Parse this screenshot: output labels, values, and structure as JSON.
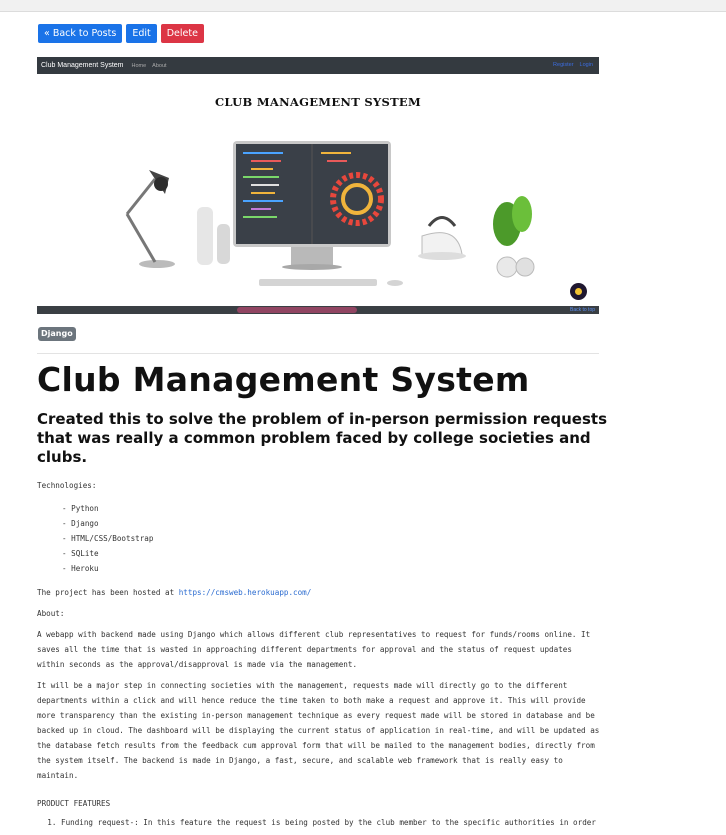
{
  "toolbar": {
    "back_label": "« Back to Posts",
    "edit_label": "Edit",
    "delete_label": "Delete"
  },
  "hero": {
    "nav_brand": "Club Management System",
    "nav_links": [
      "Home",
      "About"
    ],
    "nav_right": [
      "Register",
      "Login"
    ],
    "title": "CLUB MANAGEMENT SYSTEM"
  },
  "tag": "Django",
  "post": {
    "title": "Club Management System",
    "subtitle": "Created this to solve the problem of in-person permission requests that was really a common problem faced by college societies and clubs.",
    "technologies_label": "Technologies:",
    "technologies": [
      "- Python",
      "- Django",
      "- HTML/CSS/Bootstrap",
      "- SQLite",
      "- Heroku"
    ],
    "hosted_prefix": "The project has been hosted at ",
    "hosted_url": "https://cmsweb.herokuapp.com/",
    "about_label": "About:",
    "about_p1": "A webapp with backend made using Django which allows different club representatives to request for funds/rooms online. It saves all the time that is wasted in approaching different departments for approval and the status of request updates within seconds as the approval/disapproval is made via the management.",
    "about_p2": "It will be a major step in connecting societies with the management, requests made will directly go to the different departments within a click and will hence reduce the time taken to both make a request and approve it. This will provide more transparency than the existing in-person management technique as every request made will be stored in database and be backed up in cloud. The dashboard will be displaying the current status of application in real-time, and will be updated as the database fetch results from the feedback cum approval form that will be mailed to the management bodies, directly from the system itself. The backend is made in Django, a fast, secure, and scalable web framework that is really easy to maintain.",
    "features_label": "PRODUCT FEATURES",
    "features": [
      "Funding request-: In this feature the request is being posted by the club member to the specific authorities in order"
    ]
  }
}
